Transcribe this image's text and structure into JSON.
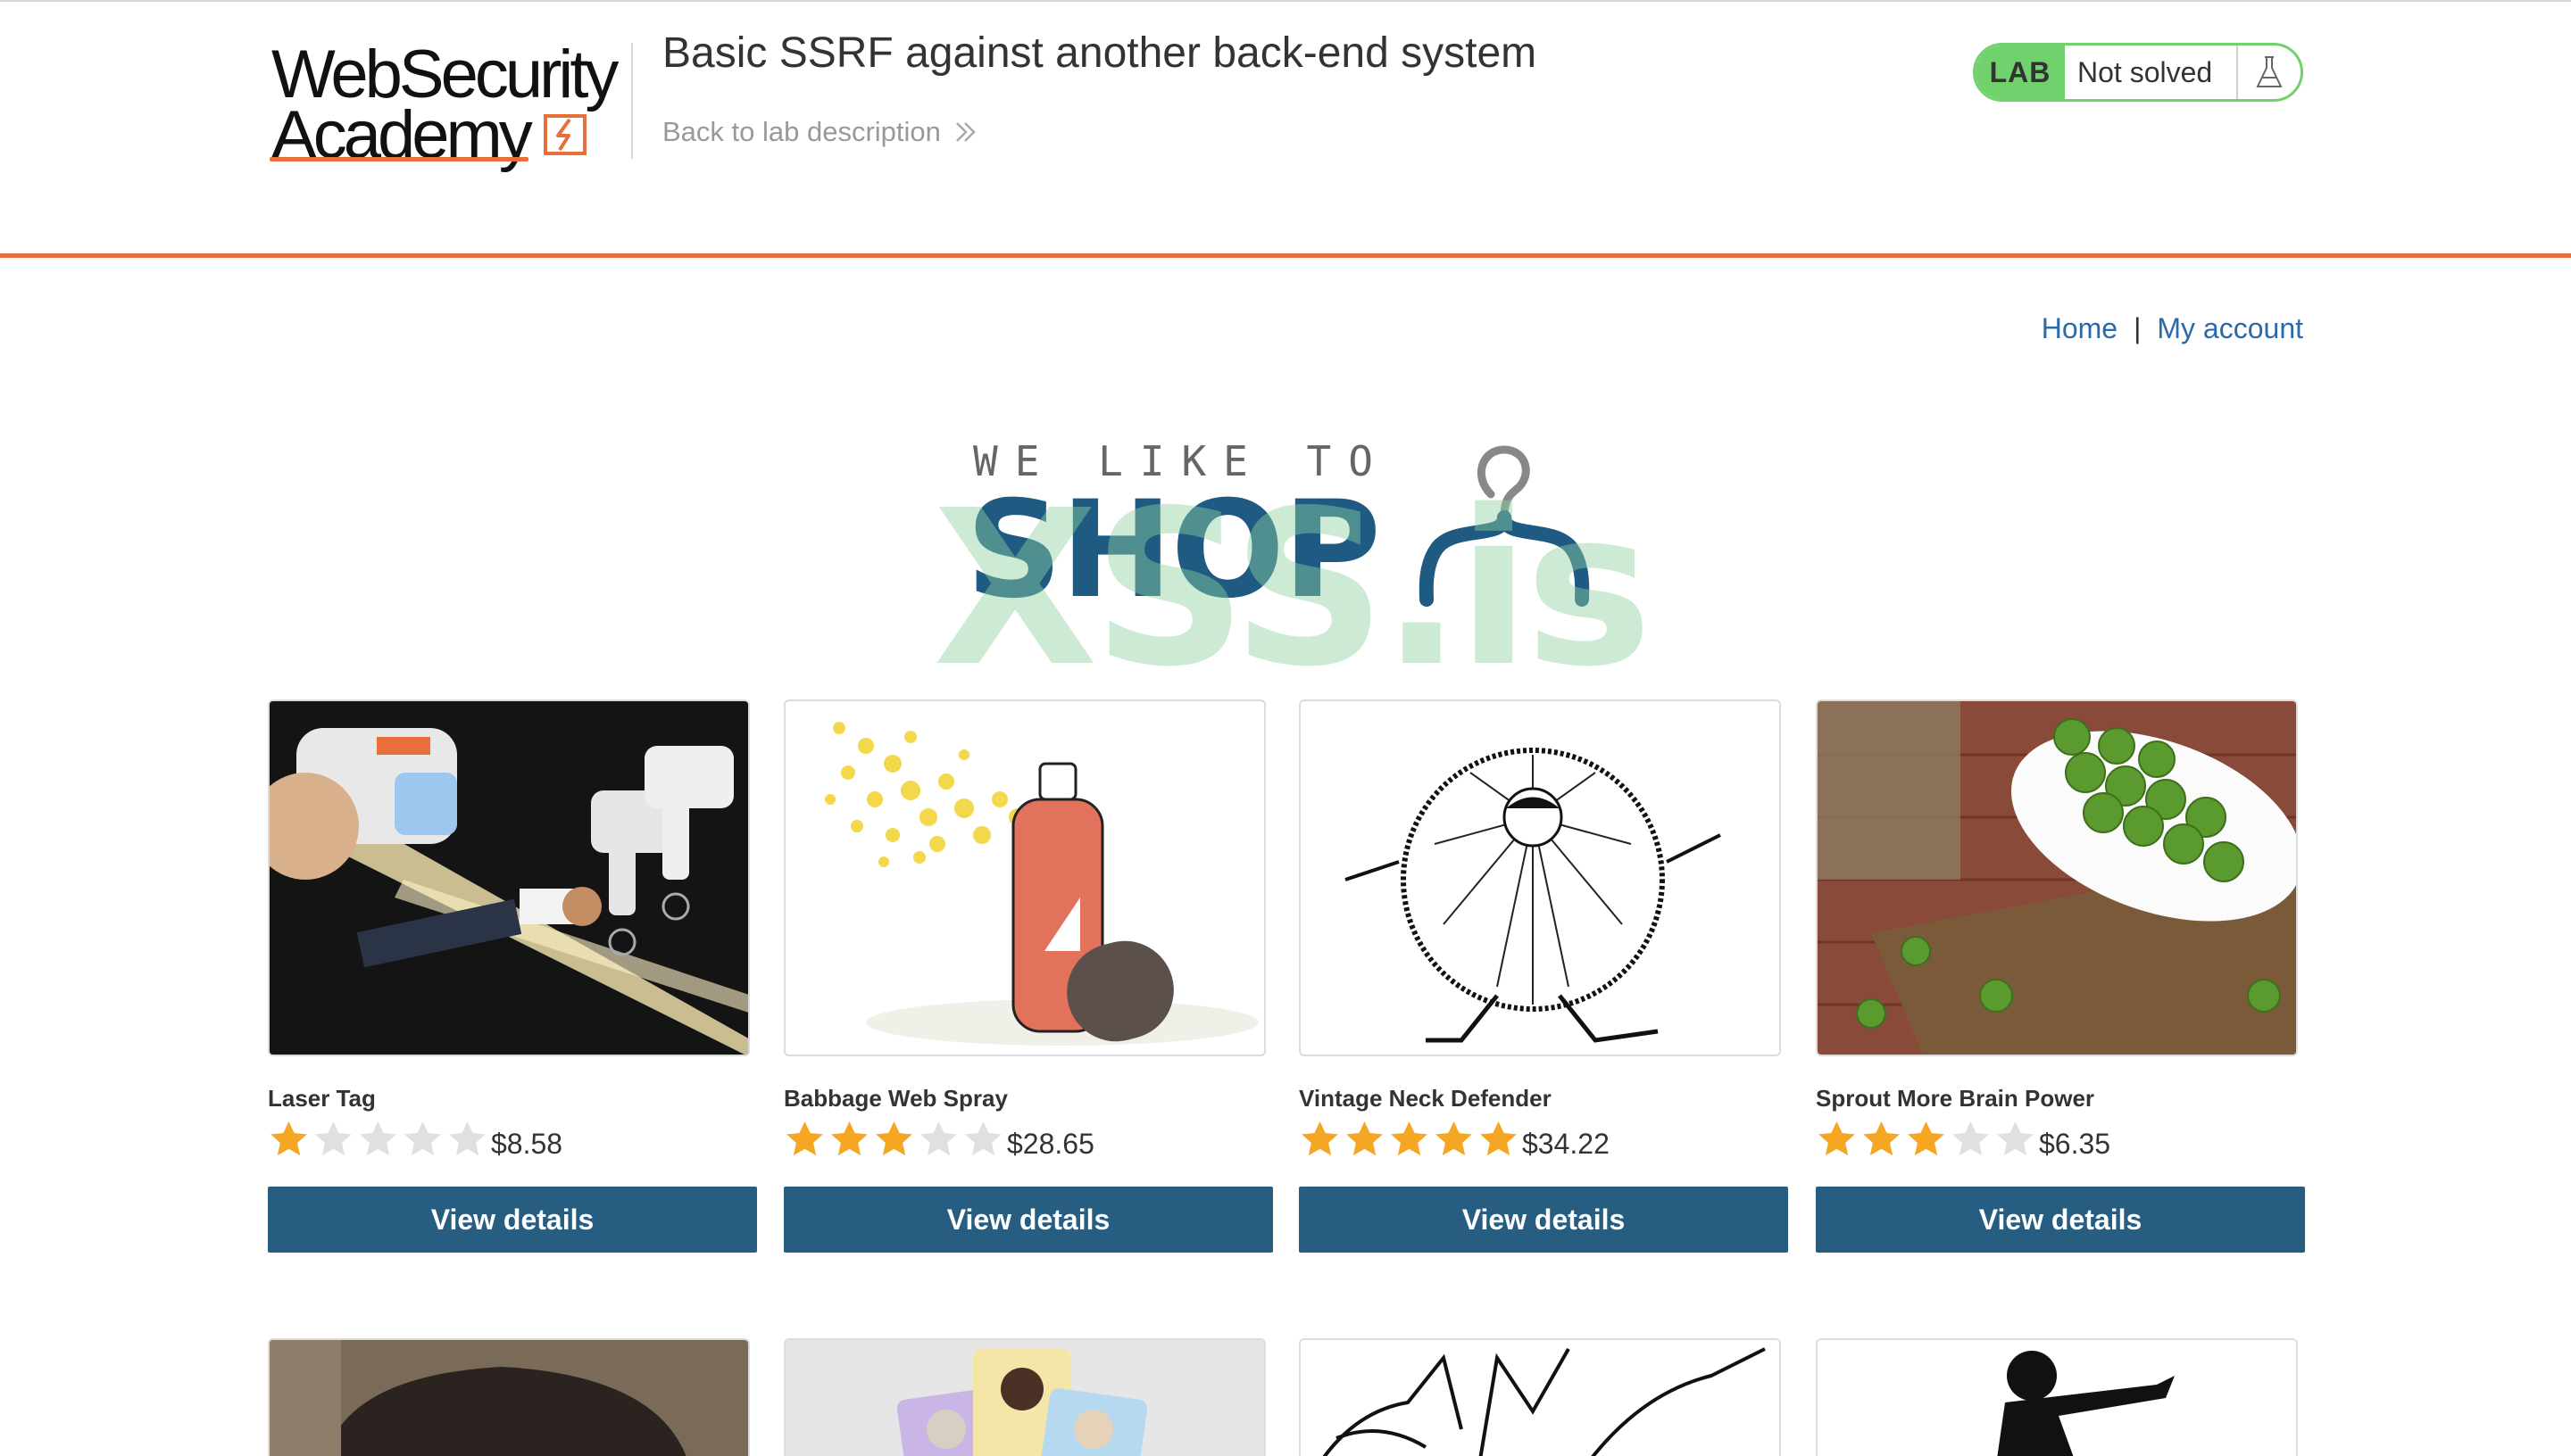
{
  "header": {
    "logo_line1": "WebSecurity",
    "logo_line2": "Academy",
    "title": "Basic SSRF against another back-end system",
    "back_link": "Back to lab description",
    "lab_badge": "LAB",
    "lab_status": "Not solved"
  },
  "nav": {
    "home": "Home",
    "separator": "|",
    "account": "My account"
  },
  "banner": {
    "tagline": "WE LIKE TO",
    "word": "SHOP",
    "watermark": "XSS.is"
  },
  "colors": {
    "accent_orange": "#e86f3a",
    "lab_green": "#70d16d",
    "button_blue": "#285d82",
    "link_blue": "#2b6aa8",
    "star_gold": "#f5a623",
    "star_empty": "#e0e0e0"
  },
  "products": [
    {
      "name": "Laser Tag",
      "rating": 1,
      "price": "$8.58",
      "button": "View details",
      "image": "laser-tag-image"
    },
    {
      "name": "Babbage Web Spray",
      "rating": 3,
      "price": "$28.65",
      "button": "View details",
      "image": "spray-can-image"
    },
    {
      "name": "Vintage Neck Defender",
      "rating": 5,
      "price": "$34.22",
      "button": "View details",
      "image": "neck-defender-image"
    },
    {
      "name": "Sprout More Brain Power",
      "rating": 3,
      "price": "$6.35",
      "button": "View details",
      "image": "sprouts-image"
    }
  ],
  "products_row2": [
    {
      "image": "hat-image"
    },
    {
      "image": "cards-image"
    },
    {
      "image": "sketch-image"
    },
    {
      "image": "silhouette-image"
    }
  ]
}
